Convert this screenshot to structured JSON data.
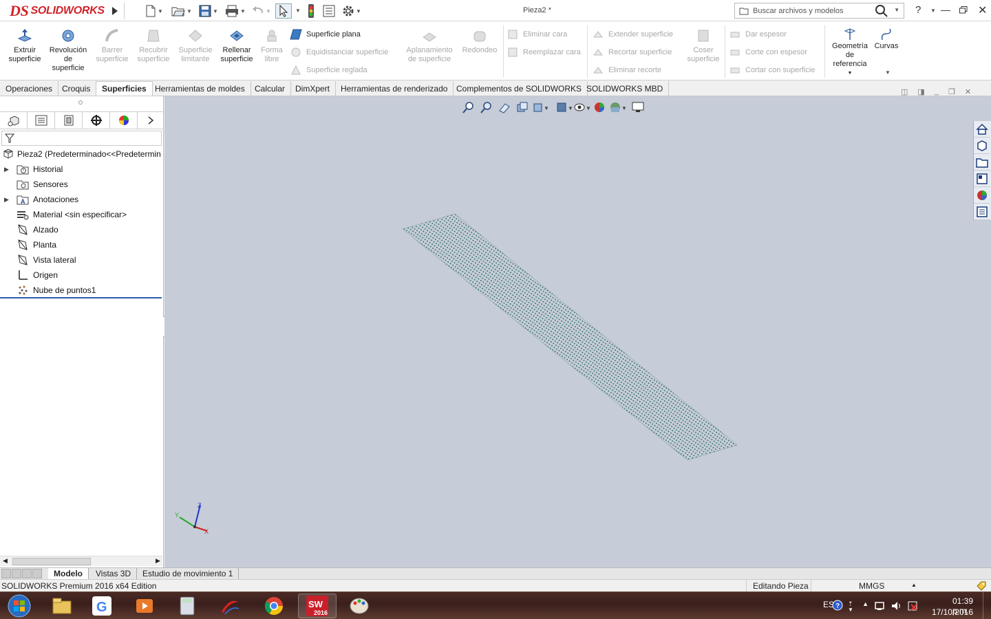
{
  "app": {
    "logo_ds": "DS",
    "logo_text": "SOLIDWORKS",
    "doc_title": "Pieza2 *",
    "search_placeholder": "Buscar archivos y modelos",
    "help_label": "?"
  },
  "ribbon": {
    "big": [
      {
        "label": "Extruir superficie",
        "enabled": true
      },
      {
        "label": "Revolución de superficie",
        "enabled": true
      },
      {
        "label": "Barrer superficie",
        "enabled": false
      },
      {
        "label": "Recubrir superficie",
        "enabled": false
      },
      {
        "label": "Superficie limitante",
        "enabled": false
      },
      {
        "label": "Rellenar superficie",
        "enabled": true
      },
      {
        "label": "Forma libre",
        "enabled": false
      }
    ],
    "col1": [
      {
        "label": "Superficie plana",
        "enabled": true
      },
      {
        "label": "Equidistanciar superficie",
        "enabled": false
      },
      {
        "label": "Superficie reglada",
        "enabled": false
      }
    ],
    "big2": [
      {
        "label": "Aplanamiento de superficie",
        "enabled": false
      },
      {
        "label": "Redondeo",
        "enabled": false
      }
    ],
    "col2": [
      {
        "label": "Eliminar cara",
        "enabled": false
      },
      {
        "label": "Reemplazar cara",
        "enabled": false
      }
    ],
    "col3": [
      {
        "label": "Extender superficie",
        "enabled": false
      },
      {
        "label": "Recortar superficie",
        "enabled": false
      },
      {
        "label": "Eliminar recorte",
        "enabled": false
      }
    ],
    "big3": [
      {
        "label": "Coser superficie",
        "enabled": false
      }
    ],
    "col4": [
      {
        "label": "Dar espesor",
        "enabled": false
      },
      {
        "label": "Corte con espesor",
        "enabled": false
      },
      {
        "label": "Cortar con superficie",
        "enabled": false
      }
    ],
    "ref_geometry": "Geometría de referencia",
    "curves": "Curvas"
  },
  "command_tabs": [
    "Operaciones",
    "Croquis",
    "Superficies",
    "Herramientas de moldes",
    "Calcular",
    "DimXpert",
    "Herramientas de renderizado",
    "Complementos de SOLIDWORKS",
    "SOLIDWORKS MBD"
  ],
  "active_tab": "Superficies",
  "tree": {
    "root": "Pieza2  (Predeterminado<<Predetermin",
    "items": [
      {
        "label": "Historial",
        "expandable": true,
        "icon": "history-folder-icon"
      },
      {
        "label": "Sensores",
        "expandable": false,
        "icon": "sensor-icon"
      },
      {
        "label": "Anotaciones",
        "expandable": true,
        "icon": "annotations-icon"
      },
      {
        "label": "Material <sin especificar>",
        "expandable": false,
        "icon": "material-icon"
      },
      {
        "label": "Alzado",
        "expandable": false,
        "icon": "plane-icon"
      },
      {
        "label": "Planta",
        "expandable": false,
        "icon": "plane-icon"
      },
      {
        "label": "Vista lateral",
        "expandable": false,
        "icon": "plane-icon"
      },
      {
        "label": "Origen",
        "expandable": false,
        "icon": "origin-icon"
      },
      {
        "label": "Nube de puntos1",
        "expandable": false,
        "icon": "point-cloud-icon"
      }
    ]
  },
  "bottom_tabs": [
    "Modelo",
    "Vistas 3D",
    "Estudio de movimiento 1"
  ],
  "status": {
    "edition": "SOLIDWORKS Premium 2016 x64 Edition",
    "mode": "Editando Pieza",
    "units": "MMGS",
    "units_caret": "▲"
  },
  "triad": {
    "x": "X",
    "y": "Y",
    "z": "Z"
  },
  "taskbar": {
    "lang": "ES",
    "time": "01:39 p.m.",
    "date": "17/10/2016",
    "sw_badge": "2016"
  },
  "colors": {
    "brand_red": "#d12229",
    "viewport_bg": "#c6ccd8",
    "point_cloud": "#2e6f66"
  }
}
